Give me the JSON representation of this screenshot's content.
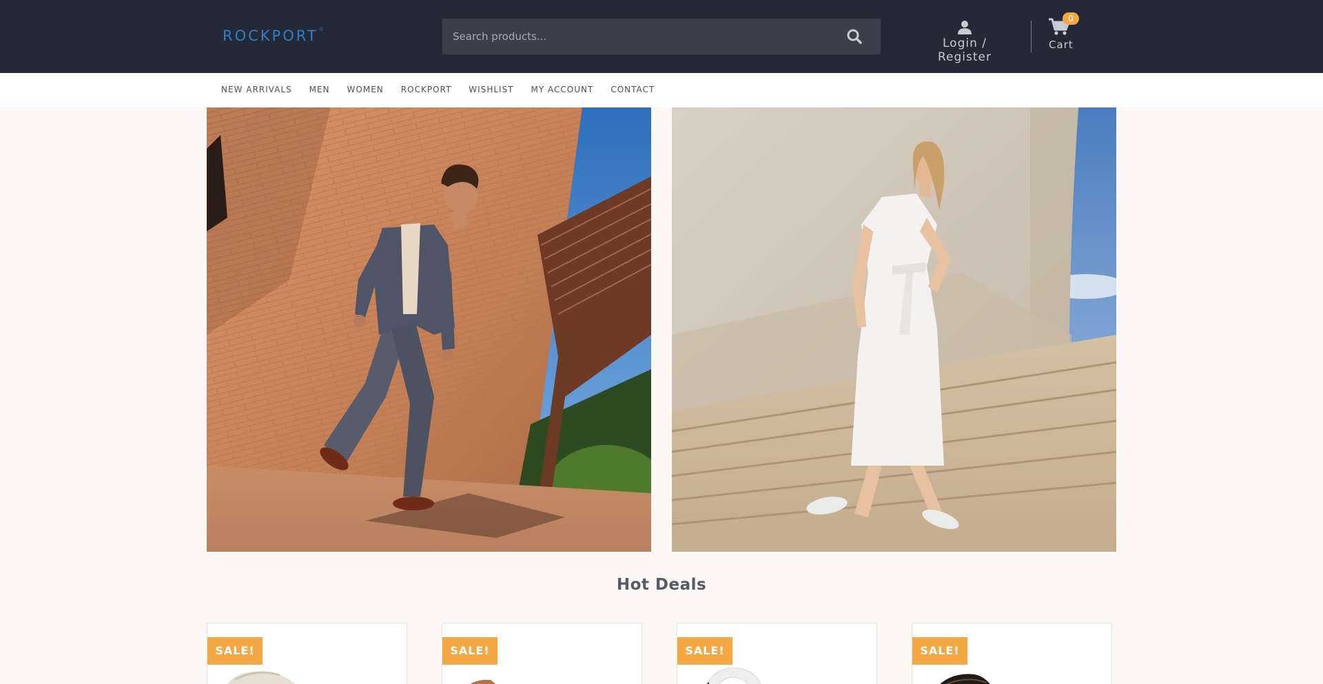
{
  "header": {
    "logo": "ROCKPORT",
    "logo_mark": "®",
    "search_placeholder": "Search products...",
    "account_label": "Login / Register",
    "cart_label": "Cart",
    "cart_count": "0"
  },
  "nav": {
    "items": [
      "NEW ARRIVALS",
      "MEN",
      "WOMEN",
      "ROCKPORT",
      "WISHLIST",
      "MY ACCOUNT",
      "CONTACT"
    ]
  },
  "section": {
    "title": "Hot Deals"
  },
  "products": [
    {
      "badge": "SALE!"
    },
    {
      "badge": "SALE!"
    },
    {
      "badge": "SALE!"
    },
    {
      "badge": "SALE!"
    }
  ],
  "colors": {
    "header_bg": "#232936",
    "accent": "#f4a844",
    "brand": "#2f7ec7",
    "page_bg": "#fdf8f5"
  }
}
